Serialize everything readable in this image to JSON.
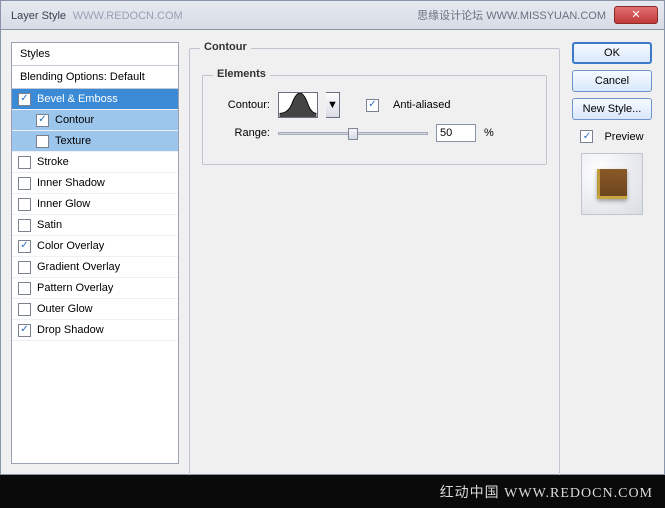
{
  "title": "Layer Style",
  "watermark_left": "WWW.REDOCN.COM",
  "watermark_right": "思缘设计论坛  WWW.MISSYUAN.COM",
  "close_glyph": "✕",
  "styles_header": "Styles",
  "blending_label": "Blending Options: Default",
  "items": [
    {
      "label": "Bevel & Emboss",
      "checked": true,
      "selected": "sel1",
      "sub": false
    },
    {
      "label": "Contour",
      "checked": true,
      "selected": "sel2",
      "sub": true
    },
    {
      "label": "Texture",
      "checked": false,
      "selected": "sel2",
      "sub": true
    },
    {
      "label": "Stroke",
      "checked": false,
      "selected": "",
      "sub": false
    },
    {
      "label": "Inner Shadow",
      "checked": false,
      "selected": "",
      "sub": false
    },
    {
      "label": "Inner Glow",
      "checked": false,
      "selected": "",
      "sub": false
    },
    {
      "label": "Satin",
      "checked": false,
      "selected": "",
      "sub": false
    },
    {
      "label": "Color Overlay",
      "checked": true,
      "selected": "",
      "sub": false
    },
    {
      "label": "Gradient Overlay",
      "checked": false,
      "selected": "",
      "sub": false
    },
    {
      "label": "Pattern Overlay",
      "checked": false,
      "selected": "",
      "sub": false
    },
    {
      "label": "Outer Glow",
      "checked": false,
      "selected": "",
      "sub": false
    },
    {
      "label": "Drop Shadow",
      "checked": true,
      "selected": "",
      "sub": false
    }
  ],
  "panel": {
    "title": "Contour",
    "elements_title": "Elements",
    "contour_label": "Contour:",
    "anti_aliased": "Anti-aliased",
    "anti_aliased_checked": true,
    "range_label": "Range:",
    "range_value": "50",
    "range_unit": "%"
  },
  "buttons": {
    "ok": "OK",
    "cancel": "Cancel",
    "new_style": "New Style...",
    "preview": "Preview",
    "preview_checked": true
  },
  "footer": "红动中国  WWW.REDOCN.COM"
}
